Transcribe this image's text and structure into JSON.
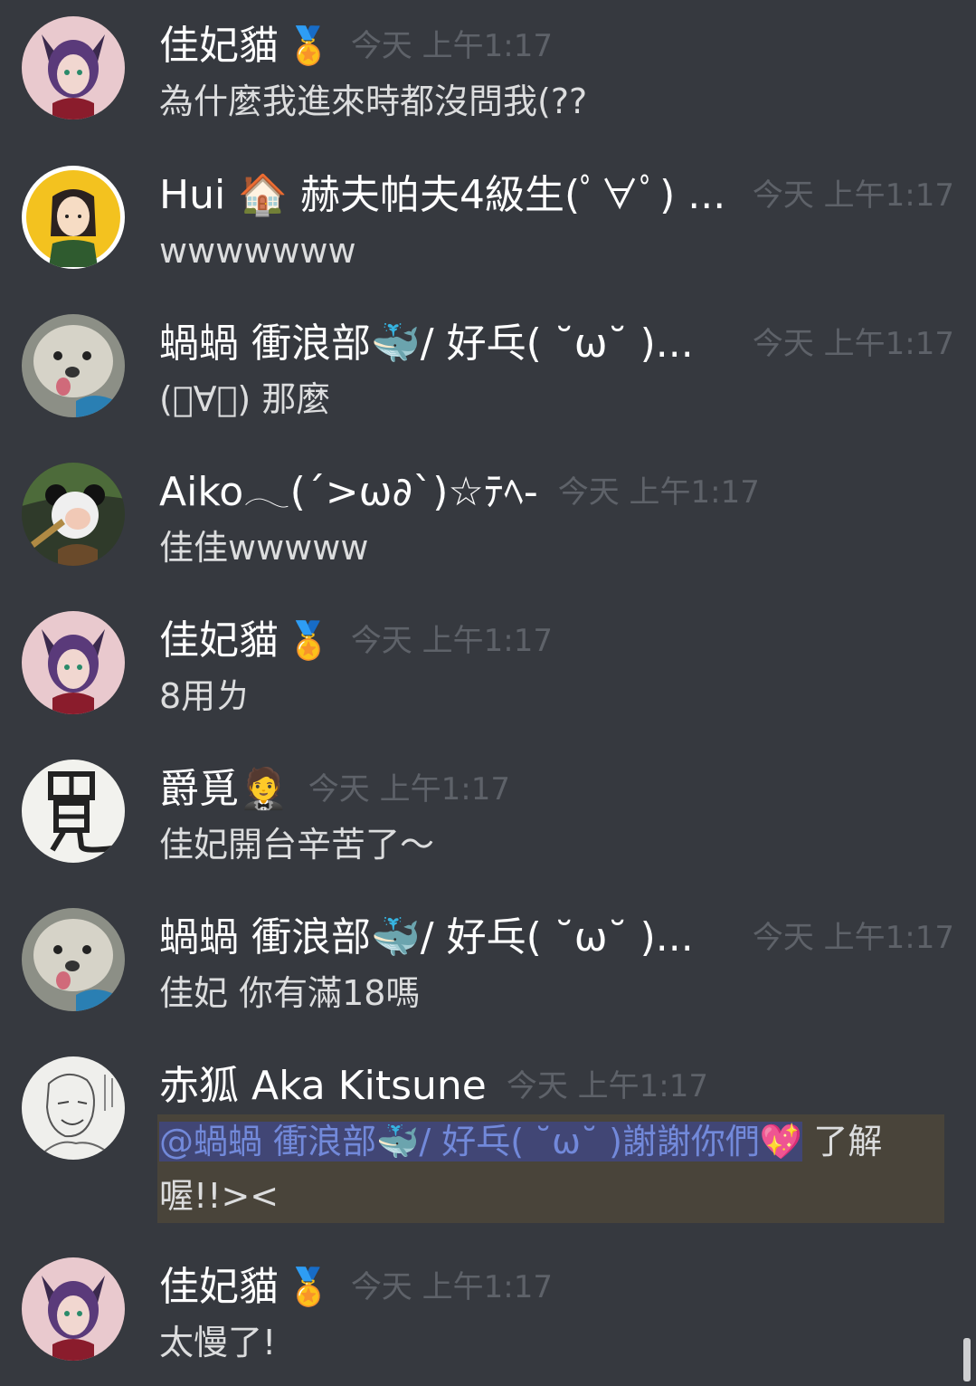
{
  "messages": [
    {
      "author": "佳妃貓",
      "badge_icon": "gold-medal",
      "badge": "🏅",
      "time": "今天 上午1:17",
      "text": "為什麼我進來時都沒問我(??"
    },
    {
      "author": "Hui 🏠 赫夫帕夫4級生(ﾟ∀ﾟ) ...",
      "time": "今天 上午1:17",
      "text": "wwwwwww"
    },
    {
      "author": "蝸蝸 衝浪部🐳/ 好乓( ˘ω˘ )...",
      "time": "今天 上午1:17",
      "text": "(ﾟ∀ﾟ) 那麼"
    },
    {
      "author": "Aiko𓂃(´>ω∂`)☆ﾃﾍ-",
      "time": "今天 上午1:17",
      "text": "佳佳wwwww"
    },
    {
      "author": "佳妃貓",
      "badge_icon": "gold-medal",
      "badge": "🏅",
      "time": "今天 上午1:17",
      "text": "8用ㄌ"
    },
    {
      "author": "爵覓🤵",
      "time": "今天 上午1:17",
      "text": "佳妃開台辛苦了～"
    },
    {
      "author": "蝸蝸 衝浪部🐳/ 好乓( ˘ω˘ )...",
      "time": "今天 上午1:17",
      "text": "佳妃 你有滿18嗎"
    },
    {
      "author": "赤狐 Aka Kitsune",
      "time": "今天 上午1:17",
      "mention": "@蝸蝸 衝浪部🐳/ 好乓( ˘ω˘ )謝謝你們💖",
      "text": " 了解喔!!><"
    },
    {
      "author": "佳妃貓",
      "badge_icon": "gold-medal",
      "badge": "🏅",
      "time": "今天 上午1:17",
      "text": "太慢了!"
    }
  ],
  "colors": {
    "background": "#36393f",
    "author": "#ffffff",
    "timestamp": "#5e6269",
    "text": "#dcddde",
    "mention": "#7289da",
    "mention_bg": "#414675",
    "highlight_bg": "#49443a"
  }
}
